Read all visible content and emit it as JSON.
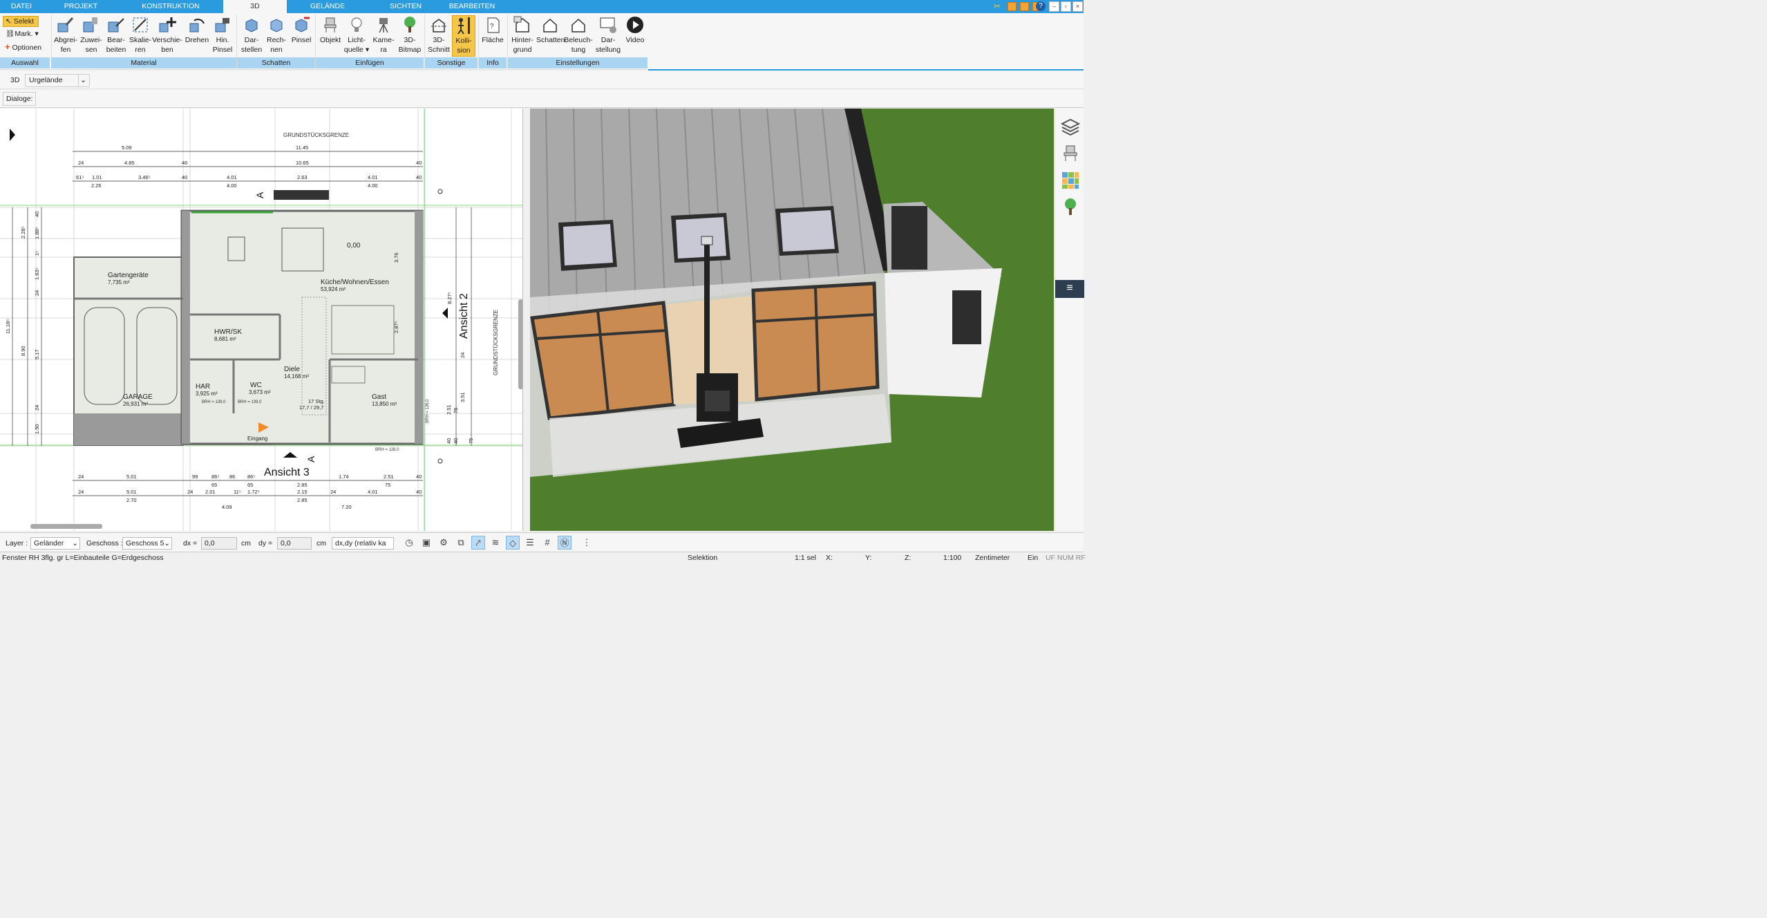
{
  "menu": {
    "tabs": [
      "DATEI",
      "PROJEKT",
      "KONSTRUKTION",
      "3D",
      "GELÄNDE",
      "SICHTEN",
      "BEARBEITEN"
    ],
    "active": "3D"
  },
  "ribbon": {
    "auswahl": {
      "select": "Selekt",
      "mark": "Mark.",
      "options": "Optionen",
      "label": "Auswahl"
    },
    "material": {
      "label": "Material",
      "buttons": [
        {
          "l1": "Abgrei-",
          "l2": "fen",
          "icon": "eyedropper-icon"
        },
        {
          "l1": "Zuwei-",
          "l2": "sen",
          "icon": "assign-material-icon"
        },
        {
          "l1": "Bear-",
          "l2": "beiten",
          "icon": "edit-material-icon"
        },
        {
          "l1": "Skalie-",
          "l2": "ren",
          "icon": "scale-icon"
        },
        {
          "l1": "Verschie-",
          "l2": "ben",
          "icon": "move-icon"
        },
        {
          "l1": "Drehen",
          "l2": "",
          "icon": "rotate-icon"
        },
        {
          "l1": "Hin.",
          "l2": "Pinsel",
          "icon": "brush-icon"
        }
      ]
    },
    "schatten": {
      "label": "Schatten",
      "buttons": [
        {
          "l1": "Dar-",
          "l2": "stellen"
        },
        {
          "l1": "Rech-",
          "l2": "nen"
        },
        {
          "l1": "Pinsel",
          "l2": ""
        }
      ]
    },
    "einfuegen": {
      "label": "Einfügen",
      "buttons": [
        {
          "l1": "Objekt",
          "l2": ""
        },
        {
          "l1": "Licht-",
          "l2": "quelle"
        },
        {
          "l1": "Kame-",
          "l2": "ra"
        },
        {
          "l1": "3D-",
          "l2": "Bitmap"
        }
      ]
    },
    "sonstige": {
      "label": "Sonstige",
      "buttons": [
        {
          "l1": "3D-",
          "l2": "Schnitt"
        },
        {
          "l1": "Kolli-",
          "l2": "sion"
        }
      ]
    },
    "info": {
      "label": "Info",
      "buttons": [
        {
          "l1": "Fläche",
          "l2": ""
        }
      ]
    },
    "einstellungen": {
      "label": "Einstellungen",
      "buttons": [
        {
          "l1": "Hinter-",
          "l2": "grund"
        },
        {
          "l1": "Schatten",
          "l2": ""
        },
        {
          "l1": "Beleuch-",
          "l2": "tung"
        },
        {
          "l1": "Dar-",
          "l2": "stellung"
        },
        {
          "l1": "Video",
          "l2": ""
        }
      ]
    }
  },
  "row3d": {
    "label": "3D",
    "terrain": "Urgelände"
  },
  "dialog": {
    "label": "Dialoge:"
  },
  "plan": {
    "grundstueck": "GRUNDSTÜCKSGRENZE",
    "rooms": [
      {
        "name": "Gartengeräte",
        "area": "7,735 m²"
      },
      {
        "name": "Küche/Wohnen/Essen",
        "area": "53,924 m²"
      },
      {
        "name": "HWR/SK",
        "area": "8,681 m²"
      },
      {
        "name": "Diele",
        "area": "14,168 m²"
      },
      {
        "name": "HAR",
        "area": "3,925 m²"
      },
      {
        "name": "WC",
        "area": "3,673 m²"
      },
      {
        "name": "GARAGE",
        "area": "26,931 m²"
      },
      {
        "name": "Gast",
        "area": "13,850 m²"
      }
    ],
    "level": "0,00",
    "stairs": "17 Stg.",
    "stairs2": "17,7 / 29,7",
    "entrance": "Eingang",
    "view2": "Ansicht 2",
    "view3": "Ansicht 3",
    "section": "A",
    "brh1": "BRH = 139,0",
    "brh2": "BRH = 139,0",
    "brh3": "BRH = 126,0",
    "brh4": "BRH = 126,0",
    "dim_top1": [
      "5.09",
      "11.45"
    ],
    "dim_top2": [
      "24",
      "4.85",
      "40",
      "10.65",
      "40"
    ],
    "dim_top3": [
      "61⁵",
      "1.01",
      "3.46⁵",
      "40",
      "4.01",
      "2.63",
      "4.01",
      "40"
    ],
    "dim_top4": [
      "2.26",
      "4.00",
      "4.00"
    ],
    "dim_bot1": [
      "24",
      "5.01",
      "99",
      "86⁵",
      "86",
      "86⁵",
      "1.74",
      "2.51",
      "40"
    ],
    "dim_bot2": [
      "65",
      "65",
      "2.85",
      "75"
    ],
    "dim_bot3": [
      "24",
      "5.01",
      "24",
      "2.01",
      "11⁵",
      "1.72⁵",
      "2.15",
      "24",
      "4.01",
      "40"
    ],
    "dim_bot4": [
      "2.70",
      "2.85"
    ],
    "dim_bot5": [
      "4.09",
      "7.20"
    ],
    "dim_left": [
      "11.18⁵",
      "8.90",
      "2.28⁵",
      "1.88⁵",
      "1⁵",
      "1.63⁵",
      "24",
      "5.17",
      "24",
      "1.50",
      "40"
    ],
    "dim_right": [
      "3.76",
      "2.87⁵",
      "8.27⁵",
      "24",
      "3.51",
      "2.51",
      "75",
      "40",
      "40",
      "75"
    ]
  },
  "layer": {
    "label": "Layer :",
    "value": "Geländer"
  },
  "geschoss": {
    "label": "Geschoss :",
    "value": "Geschoss 5"
  },
  "dx": {
    "label": "dx =",
    "value": "0,0",
    "unit": "cm"
  },
  "dy": {
    "label": "dy =",
    "value": "0,0",
    "unit": "cm"
  },
  "mode": {
    "value": "dx,dy (relativ ka"
  },
  "status": {
    "left": "Fenster RH 3flg. gr L=Einbauteile G=Erdgeschoss",
    "mode": "Selektion",
    "sel": "1:1 sel",
    "x": "X:",
    "y": "Y:",
    "z": "Z:",
    "scale": "1:100",
    "unit": "Zentimeter",
    "ein": "Ein",
    "flags": "UF NUM RF"
  }
}
